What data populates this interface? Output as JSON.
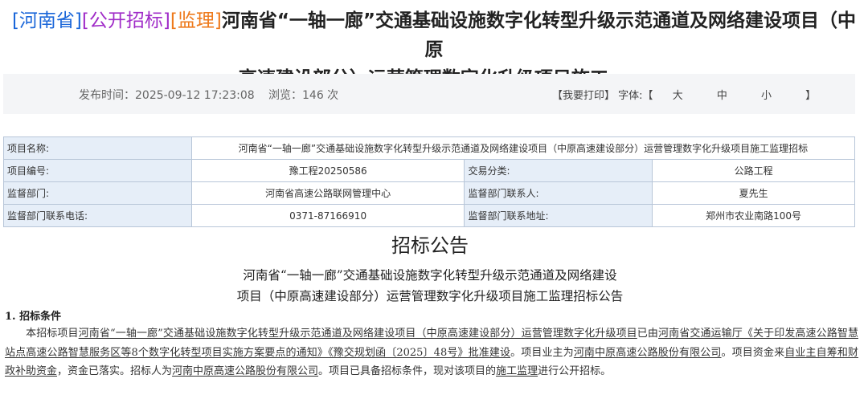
{
  "title": {
    "tag_region": "[河南省]",
    "tag_type": "[公开招标]",
    "tag_category": "[监理]",
    "line1": "河南省“一轴一廊”交通基础设施数字化转型升级示范通道及网络建设项目（中原",
    "line2": "高速建设部分）运营管理数字化升级项目施工..."
  },
  "infobar": {
    "published": "发布时间：2025-09-12 17:23:08",
    "views": "浏览：146 次",
    "print": "【我要打印】",
    "font_label": "字体:【",
    "font_large": "大",
    "font_medium": "中",
    "font_small": "小",
    "font_close": "】"
  },
  "meta_table": {
    "project_name_label": "项目名称:",
    "project_name": "河南省“一轴一廊”交通基础设施数字化转型升级示范通道及网络建设项目（中原高速建设部分）运营管理数字化升级项目施工监理招标",
    "project_no_label": "项目编号:",
    "project_no": "豫工程20250586",
    "trade_type_label": "交易分类:",
    "trade_type": "公路工程",
    "supervisor_label": "监督部门:",
    "supervisor": "河南省高速公路联网管理中心",
    "contact_label": "监督部门联系人:",
    "contact": "夏先生",
    "phone_label": "监督部门联系电话:",
    "phone": "0371-87166910",
    "address_label": "监督部门联系地址:",
    "address": "郑州市农业南路100号"
  },
  "notice": {
    "heading": "招标公告",
    "subtitle_line1": "河南省“一轴一廊”交通基础设施数字化转型升级示范通道及网络建设",
    "subtitle_line2": "项目（中原高速建设部分）运营管理数字化升级项目施工监理招标公告",
    "section1": "1. 招标条件",
    "p_1": "本招标项目",
    "p_link_project": "河南省“一轴一廊”交通基础设施数字化转型升级示范通道及网络建设项目（中原高速建设部分）运营管理数字化升级项目",
    "p_2": "已由",
    "p_link_approver": "河南省交通运输厅《关于印发高速公路智慧站点高速公路智慧服务区等8个数字化转型项目实施方案要点的通知》《豫交规划函〔2025〕48号》批准建设",
    "p_3": "。项目业主为",
    "p_link_owner": "河南中原高速公路股份有限公司",
    "p_4": "。项目资金来",
    "p_link_funds": "自业主自筹和财政补助资金",
    "p_5": "，资金已落实。招标人为",
    "p_link_tenderer": "河南中原高速公路股份有限公司",
    "p_6": "。项目已具备招标条件，现对该项目的",
    "p_link_scope": "施工监理",
    "p_7": "进行公开招标。"
  }
}
